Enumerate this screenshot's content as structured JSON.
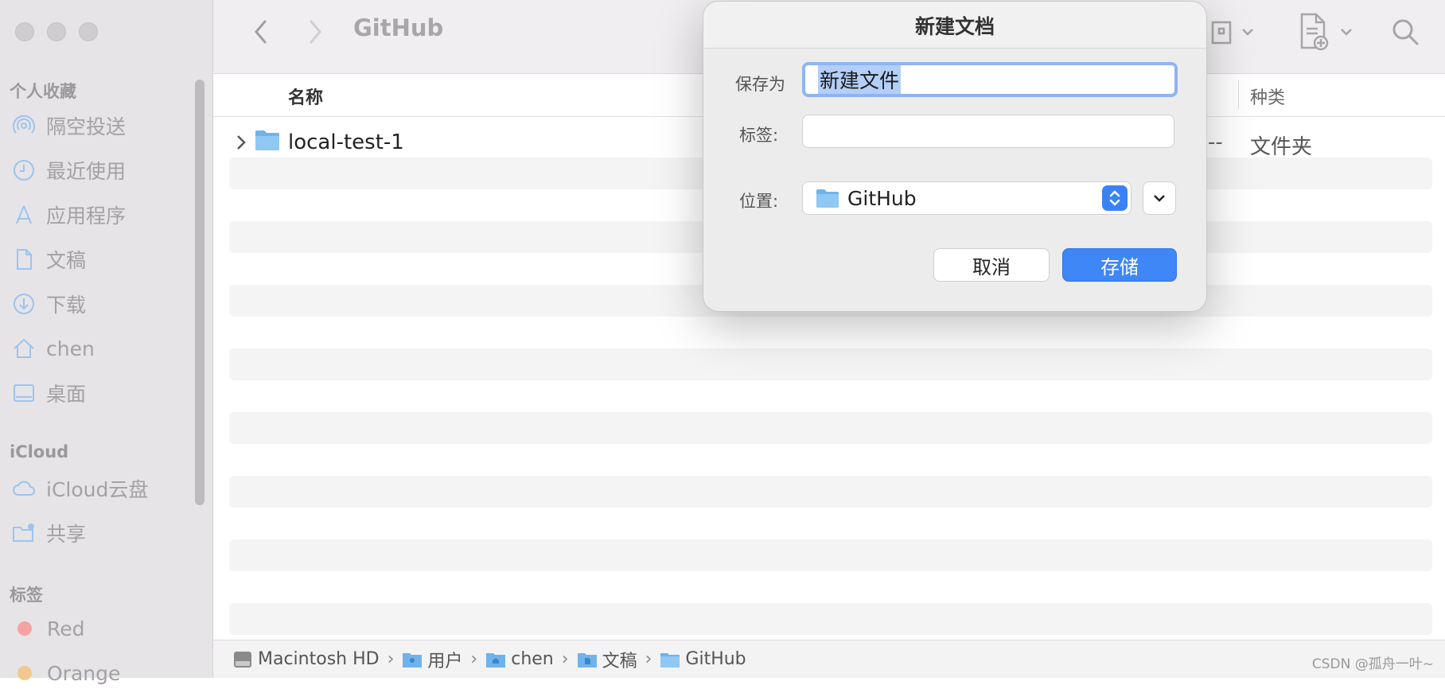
{
  "window": {
    "title": "GitHub"
  },
  "sidebar": {
    "favorites_title": "个人收藏",
    "favorites": [
      {
        "label": "隔空投送",
        "icon": "airdrop-icon"
      },
      {
        "label": "最近使用",
        "icon": "clock-icon"
      },
      {
        "label": "应用程序",
        "icon": "applications-icon"
      },
      {
        "label": "文稿",
        "icon": "document-icon"
      },
      {
        "label": "下载",
        "icon": "download-icon"
      },
      {
        "label": "chen",
        "icon": "home-icon"
      },
      {
        "label": "桌面",
        "icon": "desktop-icon"
      }
    ],
    "icloud_title": "iCloud",
    "icloud": [
      {
        "label": "iCloud云盘",
        "icon": "cloud-icon"
      },
      {
        "label": "共享",
        "icon": "shared-folder-icon"
      }
    ],
    "tags_title": "标签",
    "tags": [
      {
        "label": "Red",
        "color": "#f4a3a0"
      },
      {
        "label": "Orange",
        "color": "#f3c78d"
      }
    ]
  },
  "list": {
    "columns": {
      "name": "名称",
      "kind": "种类"
    },
    "rows": [
      {
        "name": "local-test-1",
        "size": "--",
        "kind": "文件夹"
      }
    ]
  },
  "pathbar": {
    "crumbs": [
      {
        "label": "Macintosh HD",
        "icon": "disk-icon"
      },
      {
        "label": "用户",
        "icon": "users-folder-icon"
      },
      {
        "label": "chen",
        "icon": "home-folder-icon"
      },
      {
        "label": "文稿",
        "icon": "documents-folder-icon"
      },
      {
        "label": "GitHub",
        "icon": "folder-icon"
      }
    ],
    "separator": "›"
  },
  "watermark": "CSDN @孤舟一叶~",
  "dialog": {
    "title": "新建文档",
    "save_as_label": "保存为",
    "save_as_value": "新建文件",
    "tags_label": "标签:",
    "location_label": "位置:",
    "location_value": "GitHub",
    "cancel_label": "取消",
    "save_label": "存储",
    "accent_color": "#3f86f7"
  }
}
